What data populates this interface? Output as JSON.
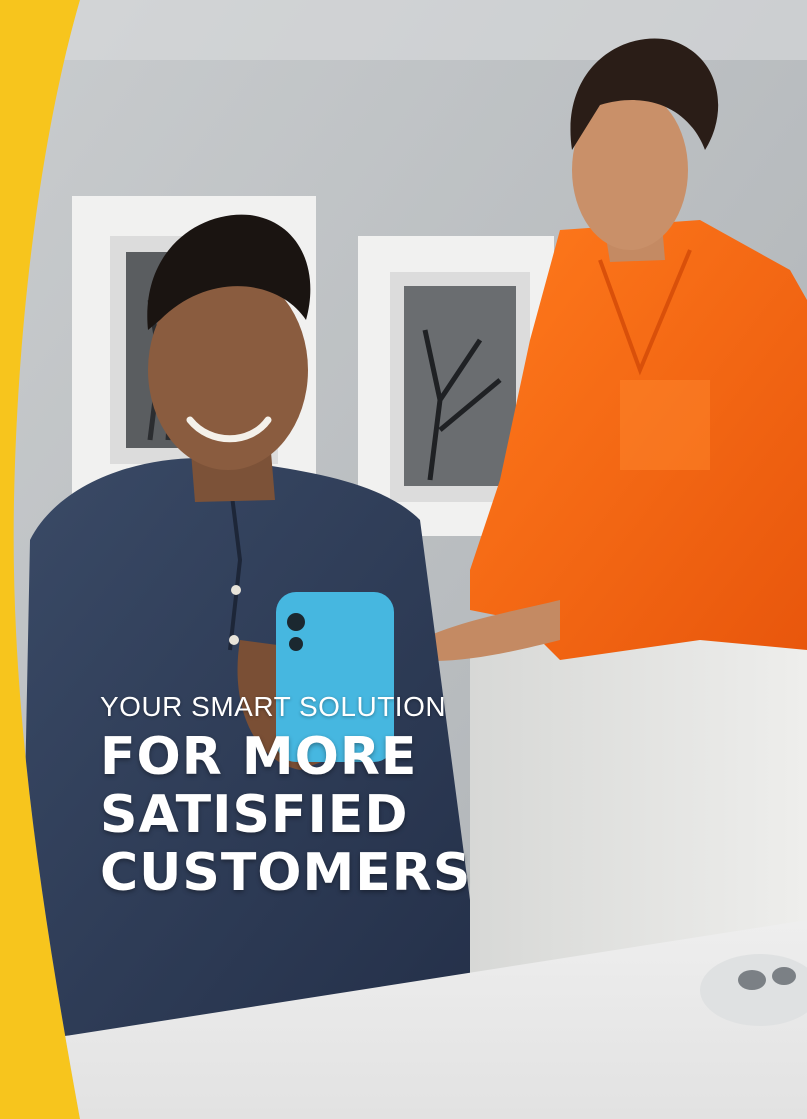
{
  "hero": {
    "tagline": "YOUR SMART SOLUTION",
    "headline_lines": [
      "FOR MORE",
      "SATISFIED",
      "CUSTOMERS"
    ]
  },
  "colors": {
    "accent_yellow": "#F7C51D",
    "text": "#FFFFFF",
    "shirt_orange": "#F36A14",
    "phone_blue": "#46B7E0",
    "denim": "#2F3D55"
  },
  "image": {
    "subject": "photo-man-and-woman-looking-at-smartphone"
  }
}
